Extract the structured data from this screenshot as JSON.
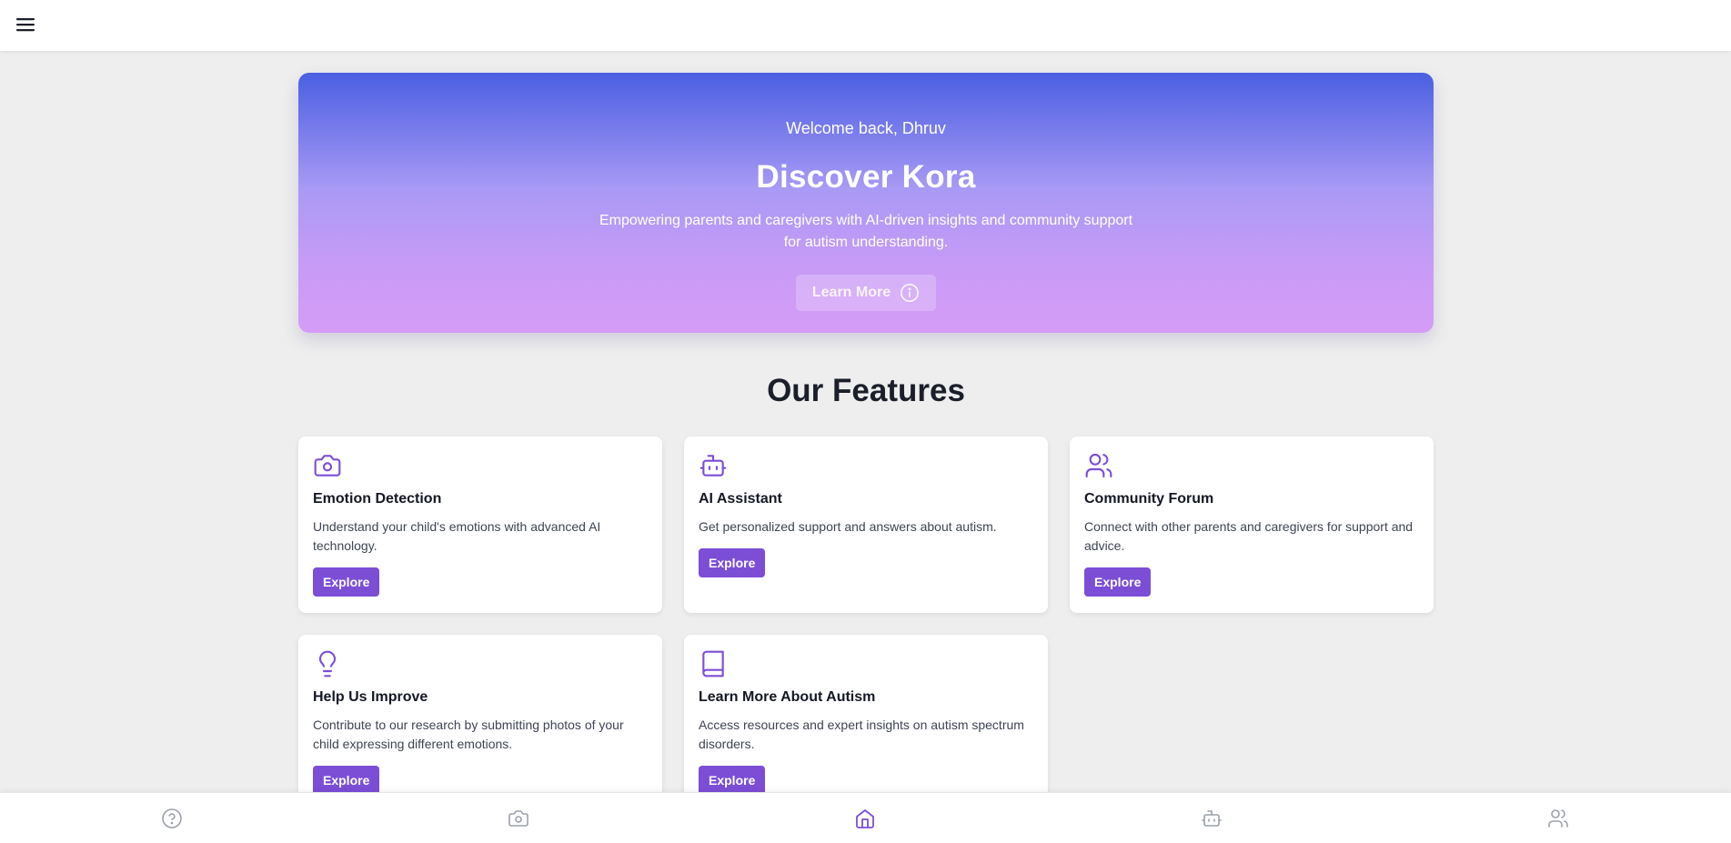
{
  "colors": {
    "accent": "#7c4ed6",
    "nav_active": "#7c4ed6",
    "nav_inactive": "#9aa0aa"
  },
  "header": {
    "menu_icon": "menu-icon"
  },
  "hero": {
    "welcome": "Welcome back, Dhruv",
    "title": "Discover Kora",
    "description": "Empowering parents and caregivers with AI-driven insights and community support for autism understanding.",
    "button_label": "Learn More",
    "button_icon": "info-icon"
  },
  "features": {
    "title": "Our Features",
    "cards": [
      {
        "icon": "camera-icon",
        "title": "Emotion Detection",
        "description": "Understand your child's emotions with advanced AI technology.",
        "button": "Explore"
      },
      {
        "icon": "bot-icon",
        "title": "AI Assistant",
        "description": "Get personalized support and answers about autism.",
        "button": "Explore"
      },
      {
        "icon": "users-icon",
        "title": "Community Forum",
        "description": "Connect with other parents and caregivers for support and advice.",
        "button": "Explore"
      },
      {
        "icon": "lightbulb-icon",
        "title": "Help Us Improve",
        "description": "Contribute to our research by submitting photos of your child expressing different emotions.",
        "button": "Explore"
      },
      {
        "icon": "book-icon",
        "title": "Learn More About Autism",
        "description": "Access resources and expert insights on autism spectrum disorders.",
        "button": "Explore"
      }
    ]
  },
  "bottom_nav": {
    "items": [
      {
        "icon": "help-circle-icon",
        "active": false
      },
      {
        "icon": "camera-icon",
        "active": false
      },
      {
        "icon": "home-icon",
        "active": true
      },
      {
        "icon": "bot-icon",
        "active": false
      },
      {
        "icon": "users-icon",
        "active": false
      }
    ]
  }
}
